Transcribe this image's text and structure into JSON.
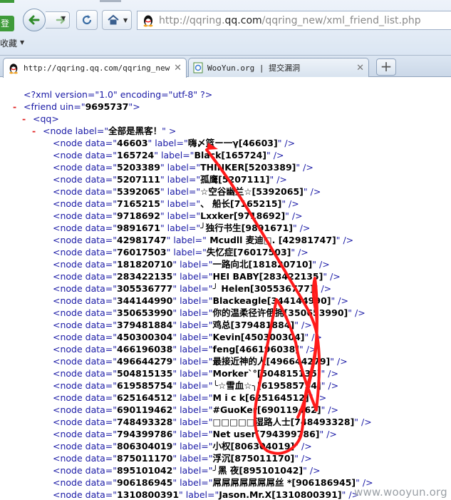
{
  "toolbar": {
    "login_label": "登录",
    "bookmarks_label": "收藏",
    "url_prefix": "http://qqring.",
    "url_domain": "qq.com",
    "url_suffix": "/qqring_new/xml_friend_list.php"
  },
  "tabs": [
    {
      "label": "http://qqring.qq.com/qqring_new...",
      "icon": "qq-penguin-icon"
    },
    {
      "label": "WooYun.org | 提交漏洞",
      "icon": "page-icon"
    }
  ],
  "xml": {
    "declaration": "<?xml version=\"1.0\" encoding=\"utf-8\" ?>",
    "friend_uin": "9695737",
    "group_label": "全部是黑客！",
    "nodes": [
      {
        "data": "46603",
        "label": "嗨〆篮ー一γ[46603]"
      },
      {
        "data": "165724",
        "label": "Black[165724]"
      },
      {
        "data": "5203389",
        "label": "THINKER[5203389]"
      },
      {
        "data": "5207111",
        "label": "孤鹰[5207111]"
      },
      {
        "data": "5392065",
        "label": "☆空谷幽兰☆[5392065]"
      },
      {
        "data": "7165215",
        "label": "、 船长[7165215]"
      },
      {
        "data": "9718692",
        "label": "Lxxker[9718692]"
      },
      {
        "data": "9891671",
        "label": "╯独行书生[9891671]"
      },
      {
        "data": "42981747",
        "label": "   Mcudll 麦迪□.          [42981747]"
      },
      {
        "data": "76017503",
        "label": "失忆症[76017503]"
      },
      {
        "data": "181820710",
        "label": "一路向北[181820710]"
      },
      {
        "data": "283422135",
        "label": "HEI BABY[283422135]"
      },
      {
        "data": "305536777",
        "label": "╯ Helen[305536777]"
      },
      {
        "data": "344144990",
        "label": "Blackeagle[344144990]"
      },
      {
        "data": "350653990",
        "label": "你的温柔径许俄拥[350653990]"
      },
      {
        "data": "379481884",
        "label": "鸡总[379481884]"
      },
      {
        "data": "450300304",
        "label": "Kevin[450300304]"
      },
      {
        "data": "466196038",
        "label": "feng[466196038]"
      },
      {
        "data": "496644279",
        "label": "最接近神的人[496644279]"
      },
      {
        "data": "504815135",
        "label": "Morker`°[504815135]"
      },
      {
        "data": "619585754",
        "label": "╰☆雪血☆╮[619585754]"
      },
      {
        "data": "625164512",
        "label": "M i c k[625164512]"
      },
      {
        "data": "690119462",
        "label": "#GuoKer[690119462]"
      },
      {
        "data": "748493328",
        "label": "□□□□□湿路人士[748493328]"
      },
      {
        "data": "794399786",
        "label": "Net user[794399786]"
      },
      {
        "data": "806304019",
        "label": "小权[806304019]"
      },
      {
        "data": "875011170",
        "label": "浮沉[875011170]"
      },
      {
        "data": "895101042",
        "label": "╯黑 夜[895101042]"
      },
      {
        "data": "906186945",
        "label": "屌屌屌屌屌屌屌丝 *[906186945]"
      },
      {
        "data": "1310800391",
        "label": "Jason.Mr.X[1310800391]"
      }
    ]
  },
  "watermark": "www.wooyun.org",
  "colors": {
    "tag": "#1a1aa6",
    "minus": "#e02020",
    "annotation": "#ff1a1a",
    "login_green": "#3f9b3a"
  }
}
